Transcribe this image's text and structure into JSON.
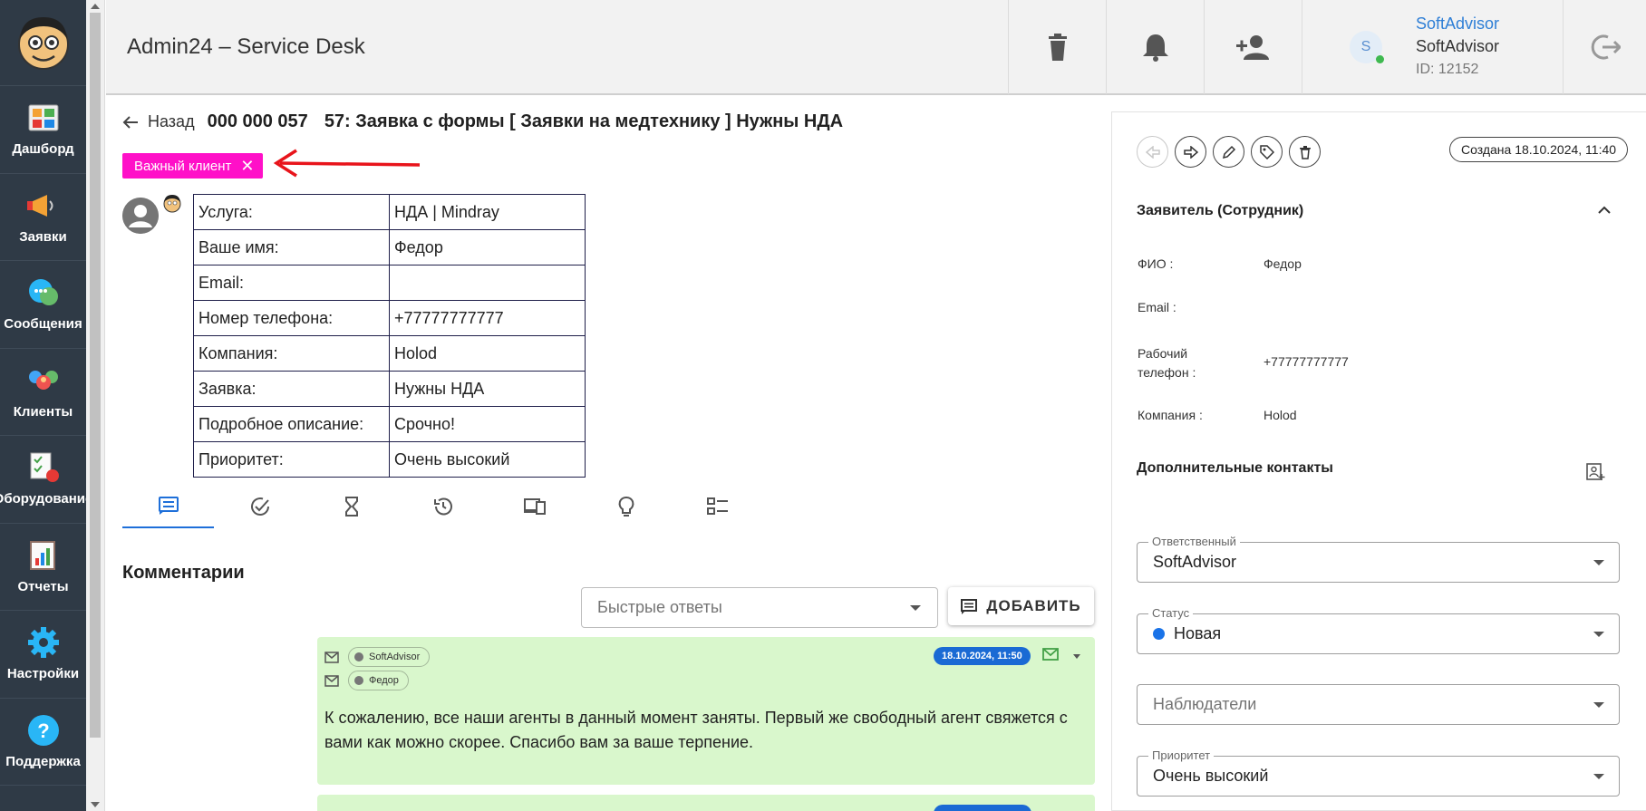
{
  "app": {
    "title": "Admin24 – Service Desk"
  },
  "nav": {
    "items": [
      {
        "label": "Дашборд",
        "icon": "dashboard-icon"
      },
      {
        "label": "Заявки",
        "icon": "megaphone-icon"
      },
      {
        "label": "Сообщения",
        "icon": "chat-icon"
      },
      {
        "label": "Клиенты",
        "icon": "clients-icon"
      },
      {
        "label": "Оборудование",
        "icon": "equipment-icon"
      },
      {
        "label": "Отчеты",
        "icon": "reports-icon"
      },
      {
        "label": "Настройки",
        "icon": "gear-icon"
      },
      {
        "label": "Поддержка",
        "icon": "help-icon"
      }
    ]
  },
  "header": {
    "user_initial": "S",
    "user_link": "SoftAdvisor",
    "user_name": "SoftAdvisor",
    "user_id": "ID: 12152"
  },
  "ticket": {
    "back_label": "Назад",
    "number": "000 000 057",
    "title": "57: Заявка с формы [ Заявки на медтехнику ] Нужны НДА",
    "tag": "Важный клиент",
    "tag_close": "✕",
    "form_rows": [
      {
        "key": "Услуга:",
        "value": "НДА | Mindray"
      },
      {
        "key": "Ваше имя:",
        "value": "Федор"
      },
      {
        "key": "Email:",
        "value": ""
      },
      {
        "key": "Номер телефона:",
        "value": "+77777777777"
      },
      {
        "key": "Компания:",
        "value": "Holod"
      },
      {
        "key": "Заявка:",
        "value": "Нужны НДА"
      },
      {
        "key": "Подробное описание:",
        "value": "Срочно!"
      },
      {
        "key": "Приоритет:",
        "value": "Очень высокий"
      }
    ]
  },
  "comments": {
    "title": "Комментарии",
    "quick_placeholder": "Быстрые ответы",
    "add_label": "ДОБАВИТЬ",
    "message": {
      "from": "SoftAdvisor",
      "to": "Федор",
      "date": "18.10.2024, 11:50",
      "text": "К сожалению, все наши агенты в данный момент заняты. Первый же свободный агент свяжется с вами как можно скорее. Спасибо вам за ваше терпение."
    }
  },
  "side": {
    "created": "Создана 18.10.2024, 11:40",
    "requester_title": "Заявитель (Сотрудник)",
    "fields": [
      {
        "label": "ФИО :",
        "value": "Федор"
      },
      {
        "label": "Email :",
        "value": ""
      },
      {
        "label": "Рабочий телефон :",
        "value": "+77777777777"
      },
      {
        "label": "Компания :",
        "value": "Holod"
      }
    ],
    "additional_contacts": "Дополнительные контакты",
    "responsible_label": "Ответственный",
    "responsible_value": "SoftAdvisor",
    "status_label": "Статус",
    "status_value": "Новая",
    "observers_placeholder": "Наблюдатели",
    "priority_label": "Приоритет",
    "priority_value": "Очень высокий"
  },
  "colors": {
    "tag": "#ff10c8",
    "accent": "#1a6ad4",
    "message_bg": "#d9f7cc",
    "nav_bg": "#2f3a46"
  }
}
